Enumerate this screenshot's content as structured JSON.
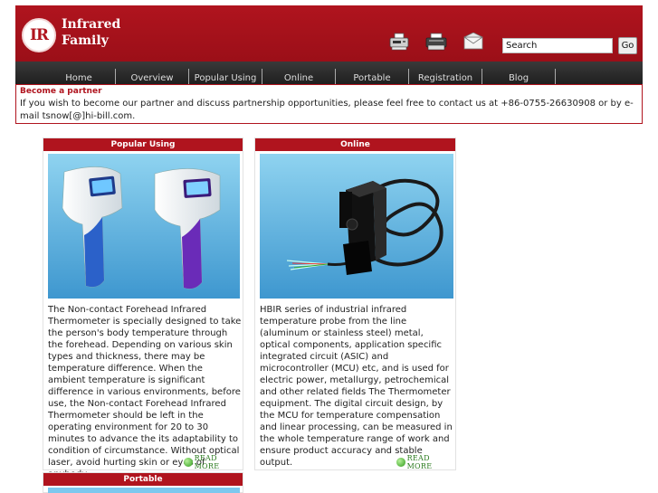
{
  "header": {
    "logo_mark": "IR",
    "logo_line1": "Infrared",
    "logo_line2": "Family",
    "icons": [
      "fax-icon",
      "printer-icon",
      "mail-icon"
    ],
    "search": {
      "value": "Search"
    },
    "go_label": "Go"
  },
  "nav": {
    "items": [
      {
        "label": "Home"
      },
      {
        "label": "Overview"
      },
      {
        "label": "Popular Using"
      },
      {
        "label": "Online"
      },
      {
        "label": "Portable"
      },
      {
        "label": "Registration"
      },
      {
        "label": "Blog"
      }
    ],
    "active_index": 0
  },
  "partner": {
    "title": "Become a partner",
    "text": "If you wish to become our partner and discuss partnership opportunities, please feel free to contact us at +86-0755-26630908 or by e-mail tsnow[@]hi-bill.com."
  },
  "cards": {
    "popular": {
      "title": "Popular Using",
      "text": "The Non-contact Forehead Infrared Thermometer is specially designed to take the person's body temperature through the forehead. Depending on various skin types and thickness, there may be temperature difference. When the ambient temperature is significant difference in various environments, before use, the Non-contact Forehead Infrared Thermometer should be left in the operating environment for 20 to 30 minutes to advance the its adaptability to condition of circumstance. Without optical laser, avoid hurting skin or eyes of anybody.",
      "read_more": "READ MORE"
    },
    "online": {
      "title": "Online",
      "text": "HBIR series of industrial infrared temperature probe from the line (aluminum or stainless steel) metal, optical components, application specific integrated circuit (ASIC) and microcontroller (MCU) etc, and is used for electric power, metallurgy, petrochemical and other related fields The Thermometer equipment. The digital circuit design, by the MCU for temperature compensation and linear processing, can be measured in the whole temperature range of work and ensure product accuracy and stable output.",
      "read_more": "READ MORE"
    },
    "portable": {
      "title": "Portable"
    }
  },
  "colors": {
    "brand_red": "#b0141e",
    "nav_dark": "#2b2b2b",
    "read_more_green": "#2a7a1e"
  }
}
